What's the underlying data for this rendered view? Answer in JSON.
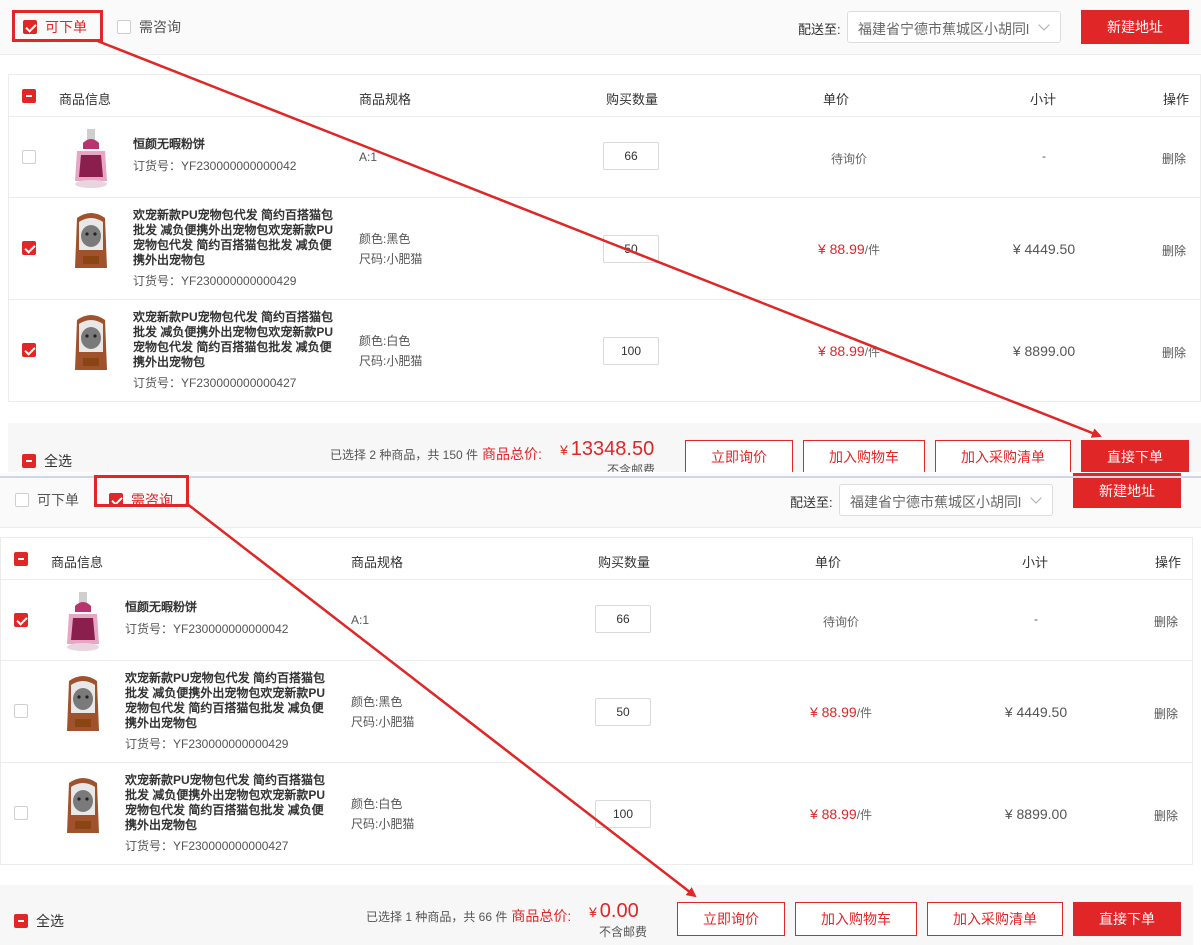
{
  "common": {
    "filter_orderable": "可下单",
    "filter_inquiry": "需咨询",
    "ship_to_label": "配送至:",
    "ship_address": "福建省宁德市蕉城区小胡同l",
    "new_address": "新建地址",
    "headers": {
      "info": "商品信息",
      "spec": "商品规格",
      "qty": "购买数量",
      "price": "单价",
      "subtotal": "小计",
      "ops": "操作"
    },
    "delete": "删除",
    "select_all": "全选",
    "total_label": "商品总价:",
    "currency": "¥",
    "no_shipping": "不含邮费",
    "btn_inquire": "立即询价",
    "btn_cart": "加入购物车",
    "btn_purchase_list": "加入采购清单",
    "btn_order": "直接下单"
  },
  "products": [
    {
      "name": "恒颜无暇粉饼",
      "sku": "订货号：YF230000000000042",
      "spec1": "A:1",
      "spec2": "",
      "price_text": "待询价",
      "unit": "",
      "subtotal": "-",
      "image": "perfume-bottle-image"
    },
    {
      "name": "欢宠新款PU宠物包代发 简约百搭猫包批发 减负便携外出宠物包欢宠新款PU宠物包代发 简约百搭猫包批发 减负便携外出宠物包",
      "sku": "订货号：YF230000000000429",
      "spec1": "颜色:黑色",
      "spec2": "尺码:小肥猫",
      "price_text": "¥ 88.99",
      "unit": "/件",
      "subtotal": "¥ 4449.50",
      "image": "pet-backpack-image"
    },
    {
      "name": "欢宠新款PU宠物包代发 简约百搭猫包批发 减负便携外出宠物包欢宠新款PU宠物包代发 简约百搭猫包批发 减负便携外出宠物包",
      "sku": "订货号：YF230000000000427",
      "spec1": "颜色:白色",
      "spec2": "尺码:小肥猫",
      "price_text": "¥ 88.99",
      "unit": "/件",
      "subtotal": "¥ 8899.00",
      "image": "pet-backpack-image"
    }
  ],
  "panel1": {
    "active_filter": "可下单",
    "quantities": [
      "66",
      "50",
      "100"
    ],
    "row_checked": [
      false,
      true,
      true
    ],
    "summary": "已选择 2 种商品，共 150 件",
    "total_amount": "13348.50"
  },
  "panel2": {
    "active_filter": "需咨询",
    "quantities": [
      "66",
      "50",
      "100"
    ],
    "row_checked": [
      true,
      false,
      false
    ],
    "summary": "已选择 1 种商品，共 66 件",
    "total_amount": "0.00"
  },
  "colors": {
    "accent": "#e02626",
    "annotation": "#e02626",
    "footer_bg": "#f7f7f7",
    "separator": "#cfd8ea"
  },
  "annotations": [
    "red box around 可下单 filter with arrow to 直接下单 button",
    "red box around 需咨询 filter with arrow to 立即询价 button"
  ]
}
